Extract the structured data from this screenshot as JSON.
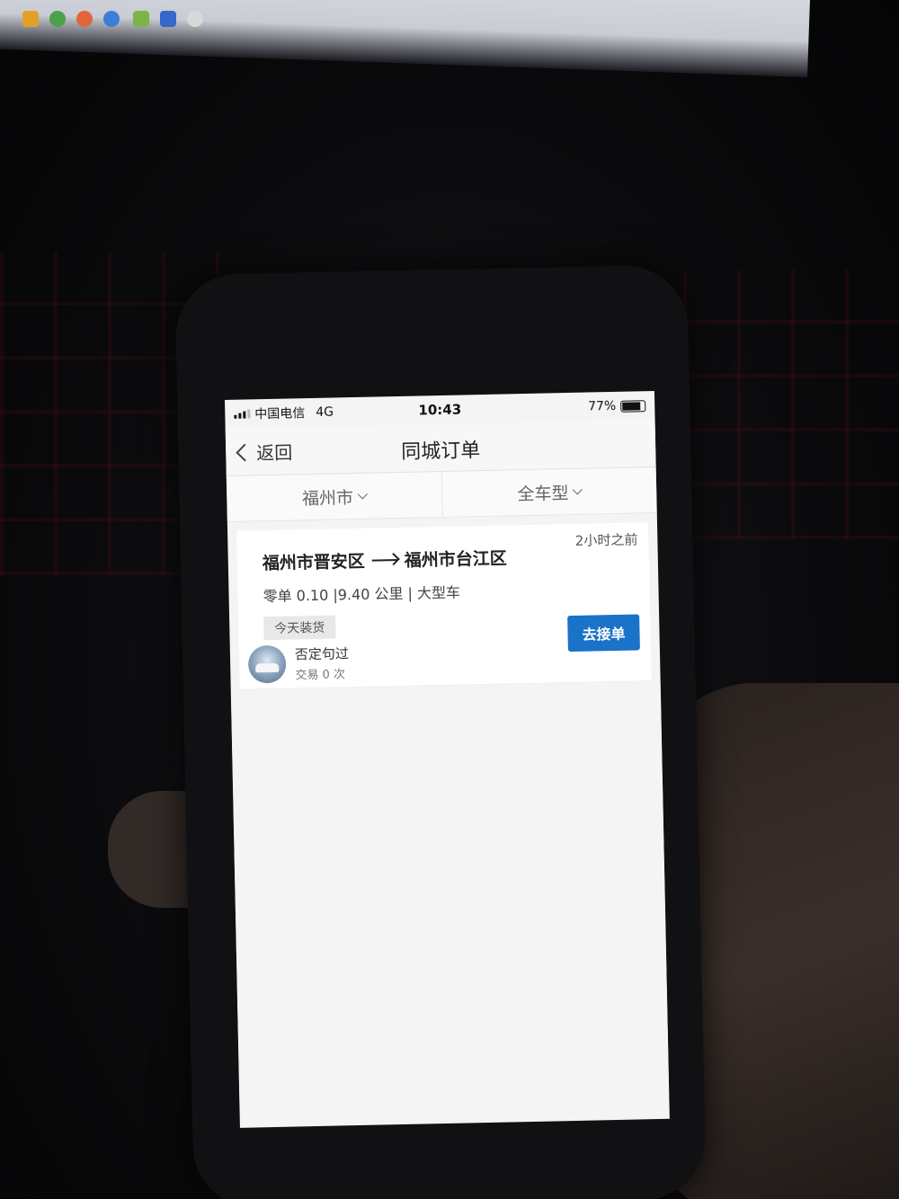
{
  "status_bar": {
    "carrier": "中国电信",
    "network": "4G",
    "time": "10:43",
    "battery_percent": "77%"
  },
  "nav": {
    "back_label": "返回",
    "title": "同城订单"
  },
  "filters": {
    "city": "福州市",
    "vehicle_type": "全车型"
  },
  "orders": [
    {
      "from": "福州市晋安区",
      "to": "福州市台江区",
      "time_ago": "2小时之前",
      "meta": "零单 0.10 |9.40 公里 | 大型车",
      "tag": "今天装货",
      "user_name": "否定句过",
      "user_trades": "交易 0 次",
      "accept_label": "去接单"
    }
  ],
  "colors": {
    "accent": "#1a72c9"
  }
}
